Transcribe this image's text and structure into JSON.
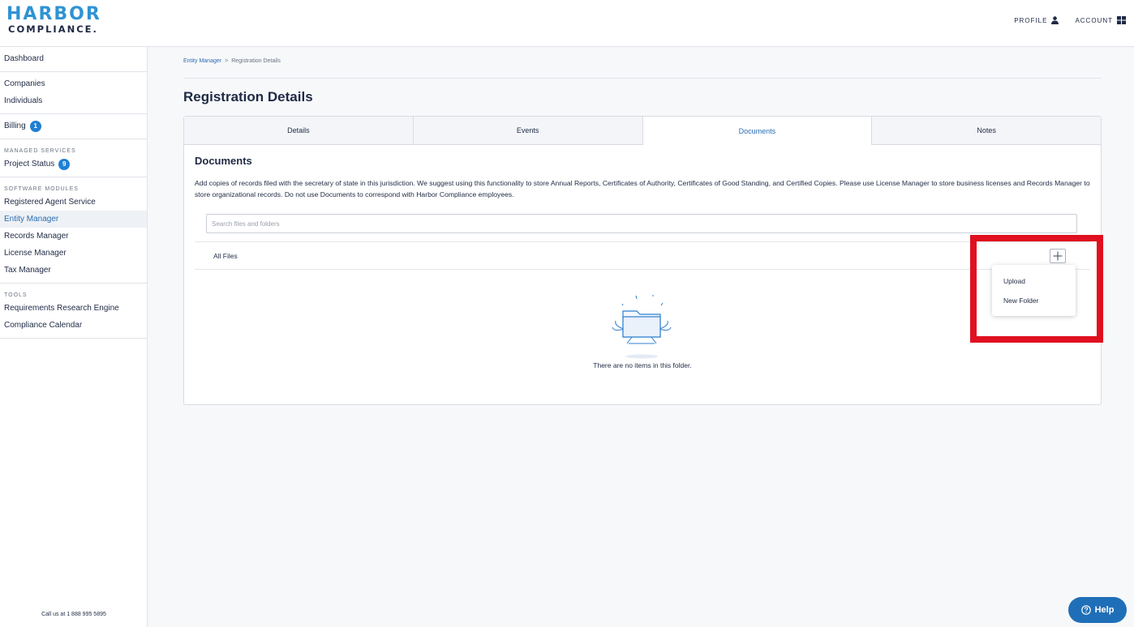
{
  "header": {
    "logo_top": "HARBOR",
    "logo_bottom": "COMPLIANCE.",
    "profile_label": "PROFILE",
    "profile_icon": "user-icon",
    "account_label": "ACCOUNT",
    "account_icon": "grid-icon"
  },
  "sidebar": {
    "dashboard": "Dashboard",
    "companies": "Companies",
    "individuals": "Individuals",
    "billing": "Billing",
    "billing_count": "1",
    "managed_services_heading": "MANAGED SERVICES",
    "project_status": "Project Status",
    "project_status_count": "9",
    "software_modules_heading": "SOFTWARE MODULES",
    "registered_agent": "Registered Agent Service",
    "entity_manager": "Entity Manager",
    "records_manager": "Records Manager",
    "license_manager": "License Manager",
    "tax_manager": "Tax Manager",
    "tools_heading": "TOOLS",
    "requirements_engine": "Requirements Research Engine",
    "compliance_calendar": "Compliance Calendar",
    "call_us": "Call us at 1 888 995 5895"
  },
  "breadcrumb": {
    "parent": "Entity Manager",
    "separator": ">",
    "current": "Registration Details"
  },
  "page": {
    "title": "Registration Details"
  },
  "tabs": [
    {
      "label": "Details"
    },
    {
      "label": "Events"
    },
    {
      "label": "Documents"
    },
    {
      "label": "Notes"
    }
  ],
  "documents": {
    "title": "Documents",
    "description": "Add copies of records filed with the secretary of state in this jurisdiction. We suggest using this functionality to store Annual Reports, Certificates of Authority, Certificates of Good Standing, and Certified Copies. Please use License Manager to store business licenses and Records Manager to store organizational records. Do not use Documents to correspond with Harbor Compliance employees.",
    "search_placeholder": "Search files and folders",
    "search_value": "",
    "all_files": "All Files",
    "empty_message": "There are no items in this folder."
  },
  "dropdown": {
    "upload": "Upload",
    "new_folder": "New Folder"
  },
  "help": {
    "label": "Help"
  },
  "colors": {
    "brand_blue": "#2f93d3",
    "navy": "#1f2a44",
    "link_blue": "#2a6db3",
    "highlight_red": "#e01020",
    "help_blue": "#1f6fb8"
  }
}
